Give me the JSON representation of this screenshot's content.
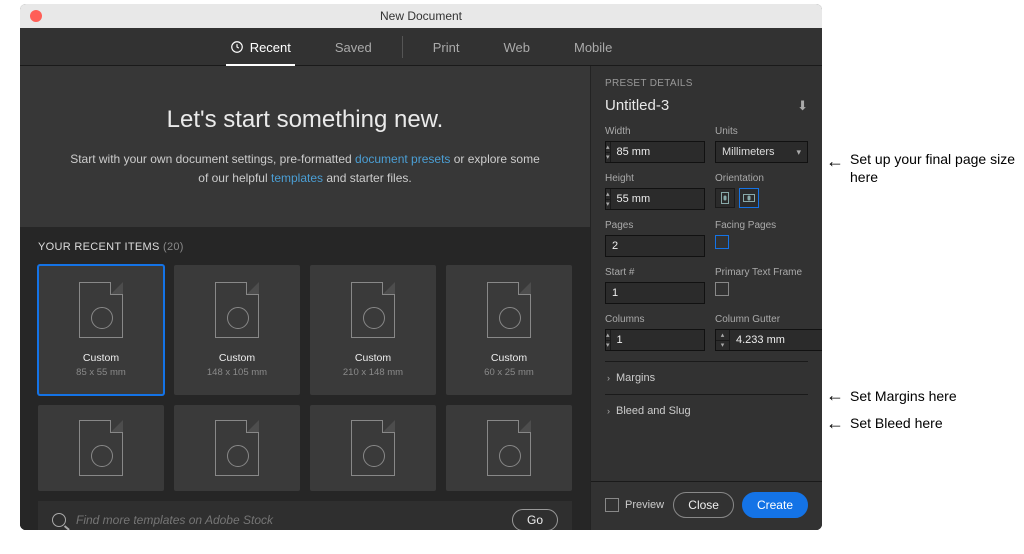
{
  "window": {
    "title": "New Document"
  },
  "tabs": [
    "Recent",
    "Saved",
    "Print",
    "Web",
    "Mobile"
  ],
  "hero": {
    "heading": "Let's start something new.",
    "pre1": "Start with your own document settings, pre-formatted ",
    "link1": "document presets",
    "mid1": " or explore some of our helpful ",
    "link2": "templates",
    "post1": " and starter files."
  },
  "recent": {
    "label": "YOUR RECENT ITEMS",
    "count": "(20)",
    "items": [
      {
        "name": "Custom",
        "dim": "85 x 55 mm"
      },
      {
        "name": "Custom",
        "dim": "148 x 105 mm"
      },
      {
        "name": "Custom",
        "dim": "210 x 148 mm"
      },
      {
        "name": "Custom",
        "dim": "60 x 25 mm"
      }
    ]
  },
  "search": {
    "placeholder": "Find more templates on Adobe Stock",
    "go": "Go"
  },
  "preset": {
    "section_label": "PRESET DETAILS",
    "doc_title": "Untitled-3",
    "width_label": "Width",
    "width_value": "85 mm",
    "units_label": "Units",
    "units_value": "Millimeters",
    "height_label": "Height",
    "height_value": "55 mm",
    "orientation_label": "Orientation",
    "pages_label": "Pages",
    "pages_value": "2",
    "facing_label": "Facing Pages",
    "start_label": "Start #",
    "start_value": "1",
    "frame_label": "Primary Text Frame",
    "columns_label": "Columns",
    "columns_value": "1",
    "gutter_label": "Column Gutter",
    "gutter_value": "4.233 mm",
    "margins_label": "Margins",
    "bleed_label": "Bleed and Slug"
  },
  "footer": {
    "preview": "Preview",
    "close": "Close",
    "create": "Create"
  },
  "annotations": {
    "a1": "Set up your final page size here",
    "a2": "Set Margins here",
    "a3": "Set Bleed here"
  }
}
